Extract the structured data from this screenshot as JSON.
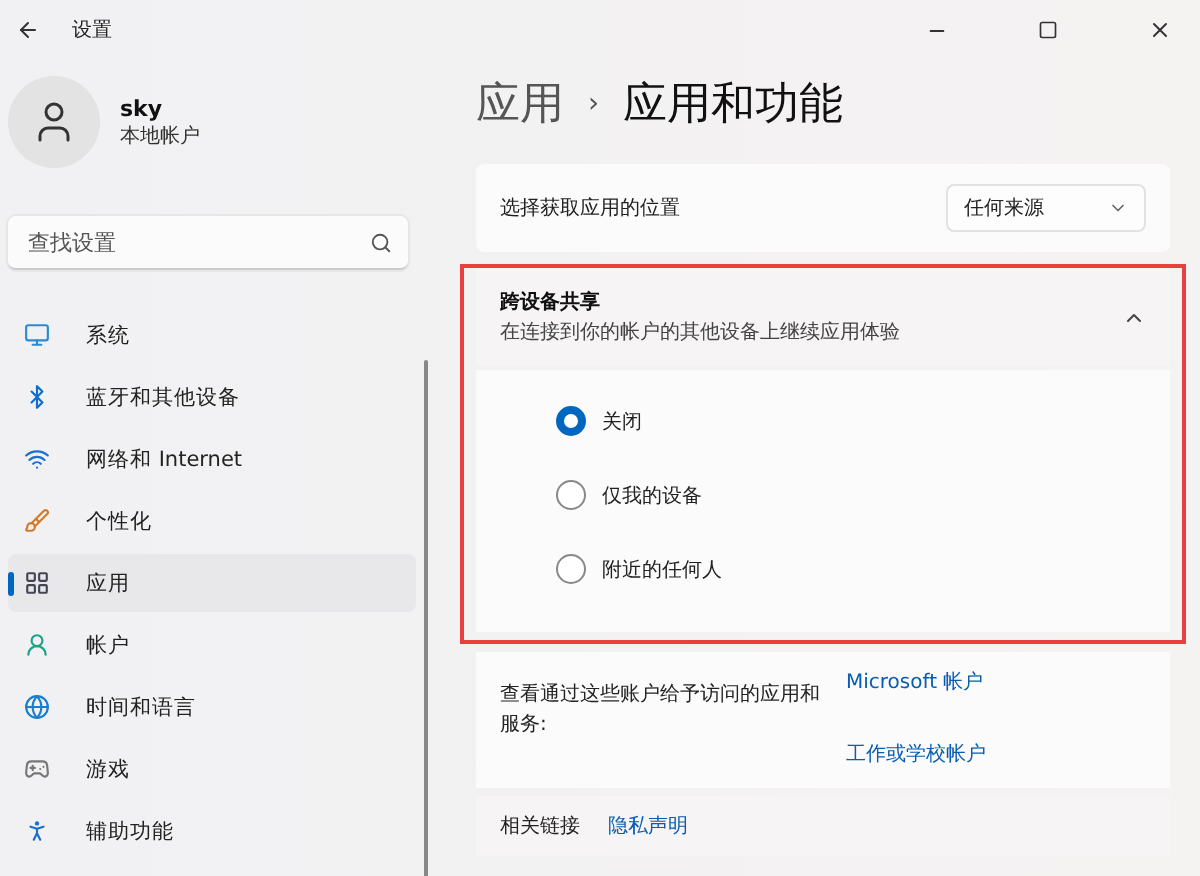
{
  "window": {
    "title": "设置"
  },
  "user": {
    "name": "sky",
    "account_type": "本地帐户"
  },
  "search": {
    "placeholder": "查找设置"
  },
  "sidebar": {
    "items": [
      {
        "label": "系统",
        "selected": false
      },
      {
        "label": "蓝牙和其他设备",
        "selected": false
      },
      {
        "label": "网络和 Internet",
        "selected": false
      },
      {
        "label": "个性化",
        "selected": false
      },
      {
        "label": "应用",
        "selected": true
      },
      {
        "label": "帐户",
        "selected": false
      },
      {
        "label": "时间和语言",
        "selected": false
      },
      {
        "label": "游戏",
        "selected": false
      },
      {
        "label": "辅助功能",
        "selected": false
      }
    ]
  },
  "breadcrumb": {
    "parent": "应用",
    "separator": "›",
    "current": "应用和功能"
  },
  "install_source": {
    "label": "选择获取应用的位置",
    "value": "任何来源"
  },
  "share": {
    "title": "跨设备共享",
    "subtitle": "在连接到你的帐户的其他设备上继续应用体验",
    "expanded": true,
    "highlighted": true,
    "options": [
      {
        "label": "关闭",
        "selected": true
      },
      {
        "label": "仅我的设备",
        "selected": false
      },
      {
        "label": "附近的任何人",
        "selected": false
      }
    ]
  },
  "accounts": {
    "label": "查看通过这些账户给予访问的应用和服务:",
    "links": [
      "Microsoft 帐户",
      "工作或学校帐户"
    ]
  },
  "related": {
    "label": "相关链接",
    "links": [
      "隐私声明"
    ]
  }
}
